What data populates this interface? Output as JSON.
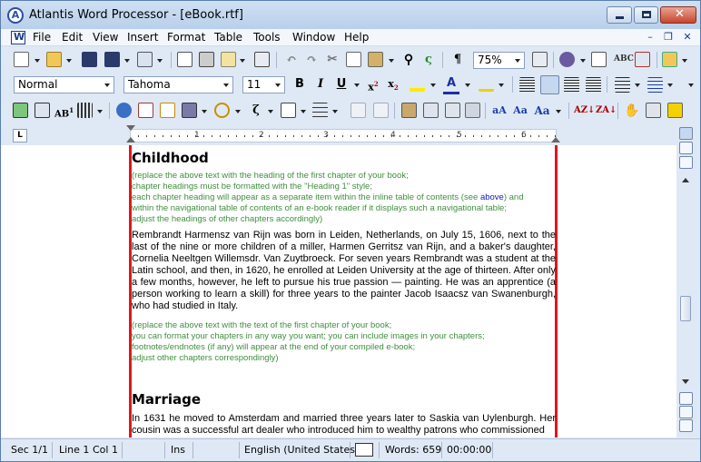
{
  "window": {
    "title": "Atlantis Word Processor - [eBook.rtf]",
    "app_icon_letter": "A"
  },
  "menu": [
    "File",
    "Edit",
    "View",
    "Insert",
    "Format",
    "Table",
    "Tools",
    "Window",
    "Help"
  ],
  "toolbar": {
    "zoom": "75%",
    "style": "Normal",
    "font": "Tahoma",
    "size": "11"
  },
  "ruler": {
    "corner": "L",
    "numbers": [
      "1",
      "2",
      "3",
      "4",
      "5",
      "6"
    ]
  },
  "document": {
    "heading1": "Childhood",
    "note1": {
      "l1": "(replace the above text with the heading of the first chapter of your book;",
      "l2": "chapter headings must be formatted with the \"Heading 1\" style;",
      "l3a": "each chapter heading will appear as a separate item within the inline table of contents (see ",
      "l3link": "above",
      "l3b": ") and",
      "l4": "within the navigational table of contents of an e-book reader if it displays such a navigational table;",
      "l5": "adjust the headings of other chapters accordingly)"
    },
    "para1": "Rembrandt Harmensz van Rijn was born in Leiden, Netherlands, on July 15, 1606, next to the last of the nine or more children of a miller, Harmen Gerritsz van Rijn, and a baker's daughter, Cornelia Neeltgen Willemsdr. Van Zuytbroeck. For seven years Rembrandt was a student at the Latin school, and then, in 1620, he enrolled at Leiden University at the age of thirteen. After only a few months, however, he left to pursue his true passion — painting. He was an apprentice (a person working to learn a skill) for three years to the painter Jacob Isaacsz van Swanenburgh, who had studied in Italy.",
    "note2": {
      "l1": "(replace the above text with the text of the first chapter of your book;",
      "l2": "you can format your chapters in any way you want; you can include images in your chapters;",
      "l3": "footnotes/endnotes (if any) will appear at the end of your compiled e-book;",
      "l4": "adjust other chapters correspondingly)"
    },
    "heading2": "Marriage",
    "para2": "In 1631 he moved to Amsterdam and married three years later to Saskia van Uylenburgh. Her cousin was a successful art dealer who introduced him to wealthy patrons who commissioned"
  },
  "status": {
    "section": "Sec 1/1",
    "line": "Line 1",
    "col": "Col 1",
    "ins": "Ins",
    "language": "English (United States)",
    "words": "Words: 659",
    "time": "00:00:00"
  },
  "colors": {
    "margin": "#e0161b",
    "note": "#3f8f3f",
    "link": "#1020c0",
    "chrome": "#dfe9f5"
  }
}
